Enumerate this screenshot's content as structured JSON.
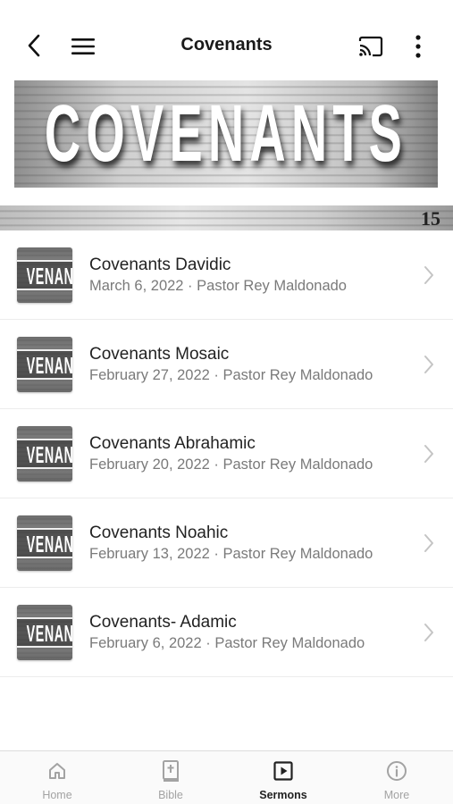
{
  "header": {
    "title": "Covenants",
    "back_icon": "chevron-left-icon",
    "menu_icon": "hamburger-menu-icon",
    "cast_icon": "cast-icon",
    "more_icon": "vertical-dots-icon"
  },
  "banner": {
    "title": "COVENANTS",
    "page_number": "15"
  },
  "thumbnail_text": "VENANT",
  "sermons": [
    {
      "title": "Covenants Davidic",
      "subtitle": "March 6, 2022 · Pastor Rey Maldonado"
    },
    {
      "title": "Covenants Mosaic",
      "subtitle": "February 27, 2022 · Pastor Rey Maldonado"
    },
    {
      "title": "Covenants Abrahamic",
      "subtitle": "February 20, 2022 · Pastor Rey Maldonado"
    },
    {
      "title": "Covenants Noahic",
      "subtitle": "February 13, 2022 · Pastor Rey Maldonado"
    },
    {
      "title": "Covenants- Adamic",
      "subtitle": "February 6, 2022 · Pastor Rey Maldonado"
    }
  ],
  "tabs": [
    {
      "label": "Home",
      "icon": "home-icon",
      "active": false
    },
    {
      "label": "Bible",
      "icon": "bible-icon",
      "active": false
    },
    {
      "label": "Sermons",
      "icon": "play-square-icon",
      "active": true
    },
    {
      "label": "More",
      "icon": "info-circle-icon",
      "active": false
    }
  ],
  "colors": {
    "active_tab": "#222222",
    "inactive_tab": "#a3a3a3",
    "subtitle": "#7a7a7a"
  }
}
